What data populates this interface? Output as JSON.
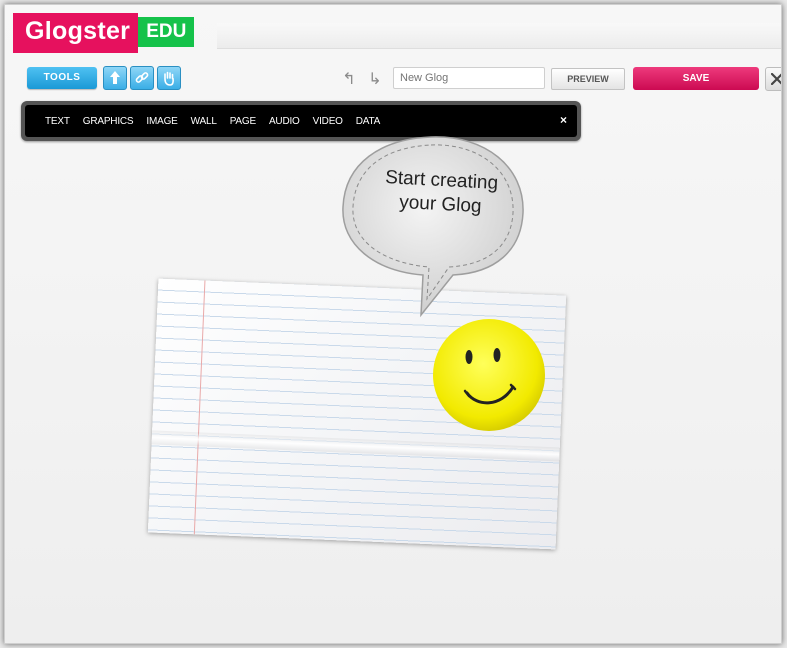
{
  "app": {
    "logo_text": "Glogster",
    "logo_badge": "EDU",
    "brand_color": "#e6115e",
    "badge_color": "#15c24a"
  },
  "toolbar": {
    "tools_label": "TOOLS",
    "icon_buttons": [
      "upload-icon",
      "link-icon",
      "hand-icon"
    ],
    "undo_icon": "undo-icon",
    "redo_icon": "redo-icon",
    "title_placeholder": "New Glog",
    "preview_label": "PREVIEW",
    "save_label": "SAVE",
    "close_label": "✕"
  },
  "tools_menu": {
    "items": [
      "TEXT",
      "GRAPHICS",
      "IMAGE",
      "WALL",
      "PAGE",
      "AUDIO",
      "VIDEO",
      "DATA"
    ],
    "close_label": "×"
  },
  "canvas": {
    "bubble_line1": "Start creating",
    "bubble_line2": "your Glog",
    "sticker": "smiley-icon"
  }
}
